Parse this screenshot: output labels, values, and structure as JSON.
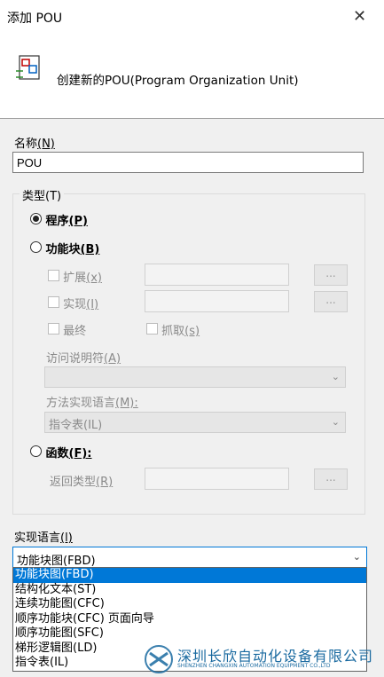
{
  "window": {
    "title": "添加 POU",
    "close_glyph": "✕"
  },
  "header": {
    "icon": "pou-icon",
    "text": "创建新的POU(Program Organization Unit)"
  },
  "name": {
    "label": "名称",
    "hotkey": "(N)",
    "value": "POU"
  },
  "type_group": {
    "label": "类型(T)",
    "program": {
      "label": "程序",
      "hotkey": "(P)",
      "selected": true
    },
    "function_block": {
      "label": "功能块",
      "hotkey": "(B)",
      "selected": false
    },
    "extends": {
      "label": "扩展",
      "hotkey": "(x)",
      "button": "..."
    },
    "implements": {
      "label": "实现",
      "hotkey": "(I)",
      "button": "..."
    },
    "final": {
      "label": "最终"
    },
    "abstract": {
      "label": "抓取",
      "hotkey": "(s)"
    },
    "access_spec": {
      "label": "访问说明符",
      "hotkey": "(A)"
    },
    "method_lang": {
      "label": "方法实现语言",
      "hotkey": "(M):",
      "value": "指令表(IL)"
    },
    "function": {
      "label": "函数",
      "hotkey": "(F):",
      "selected": false
    },
    "return_type": {
      "label": "返回类型",
      "hotkey": "(R)",
      "button": "..."
    }
  },
  "impl_language": {
    "label": "实现语言",
    "hotkey": "(l)",
    "value": "功能块图(FBD)",
    "options": [
      "功能块图(FBD)",
      "结构化文本(ST)",
      "连续功能图(CFC)",
      "顺序功能块(CFC) 页面向导",
      "顺序功能图(SFC)",
      "梯形逻辑图(LD)",
      "指令表(IL)"
    ],
    "selected_index": 0
  },
  "watermark": {
    "cn": "深圳长欣自动化设备有限公司",
    "en": "SHENZHEN CHANGXIN AUTOMATION EQUIPMENT CO.,LTD"
  },
  "colors": {
    "accent": "#0078d7",
    "watermark": "#1a6aa0"
  }
}
